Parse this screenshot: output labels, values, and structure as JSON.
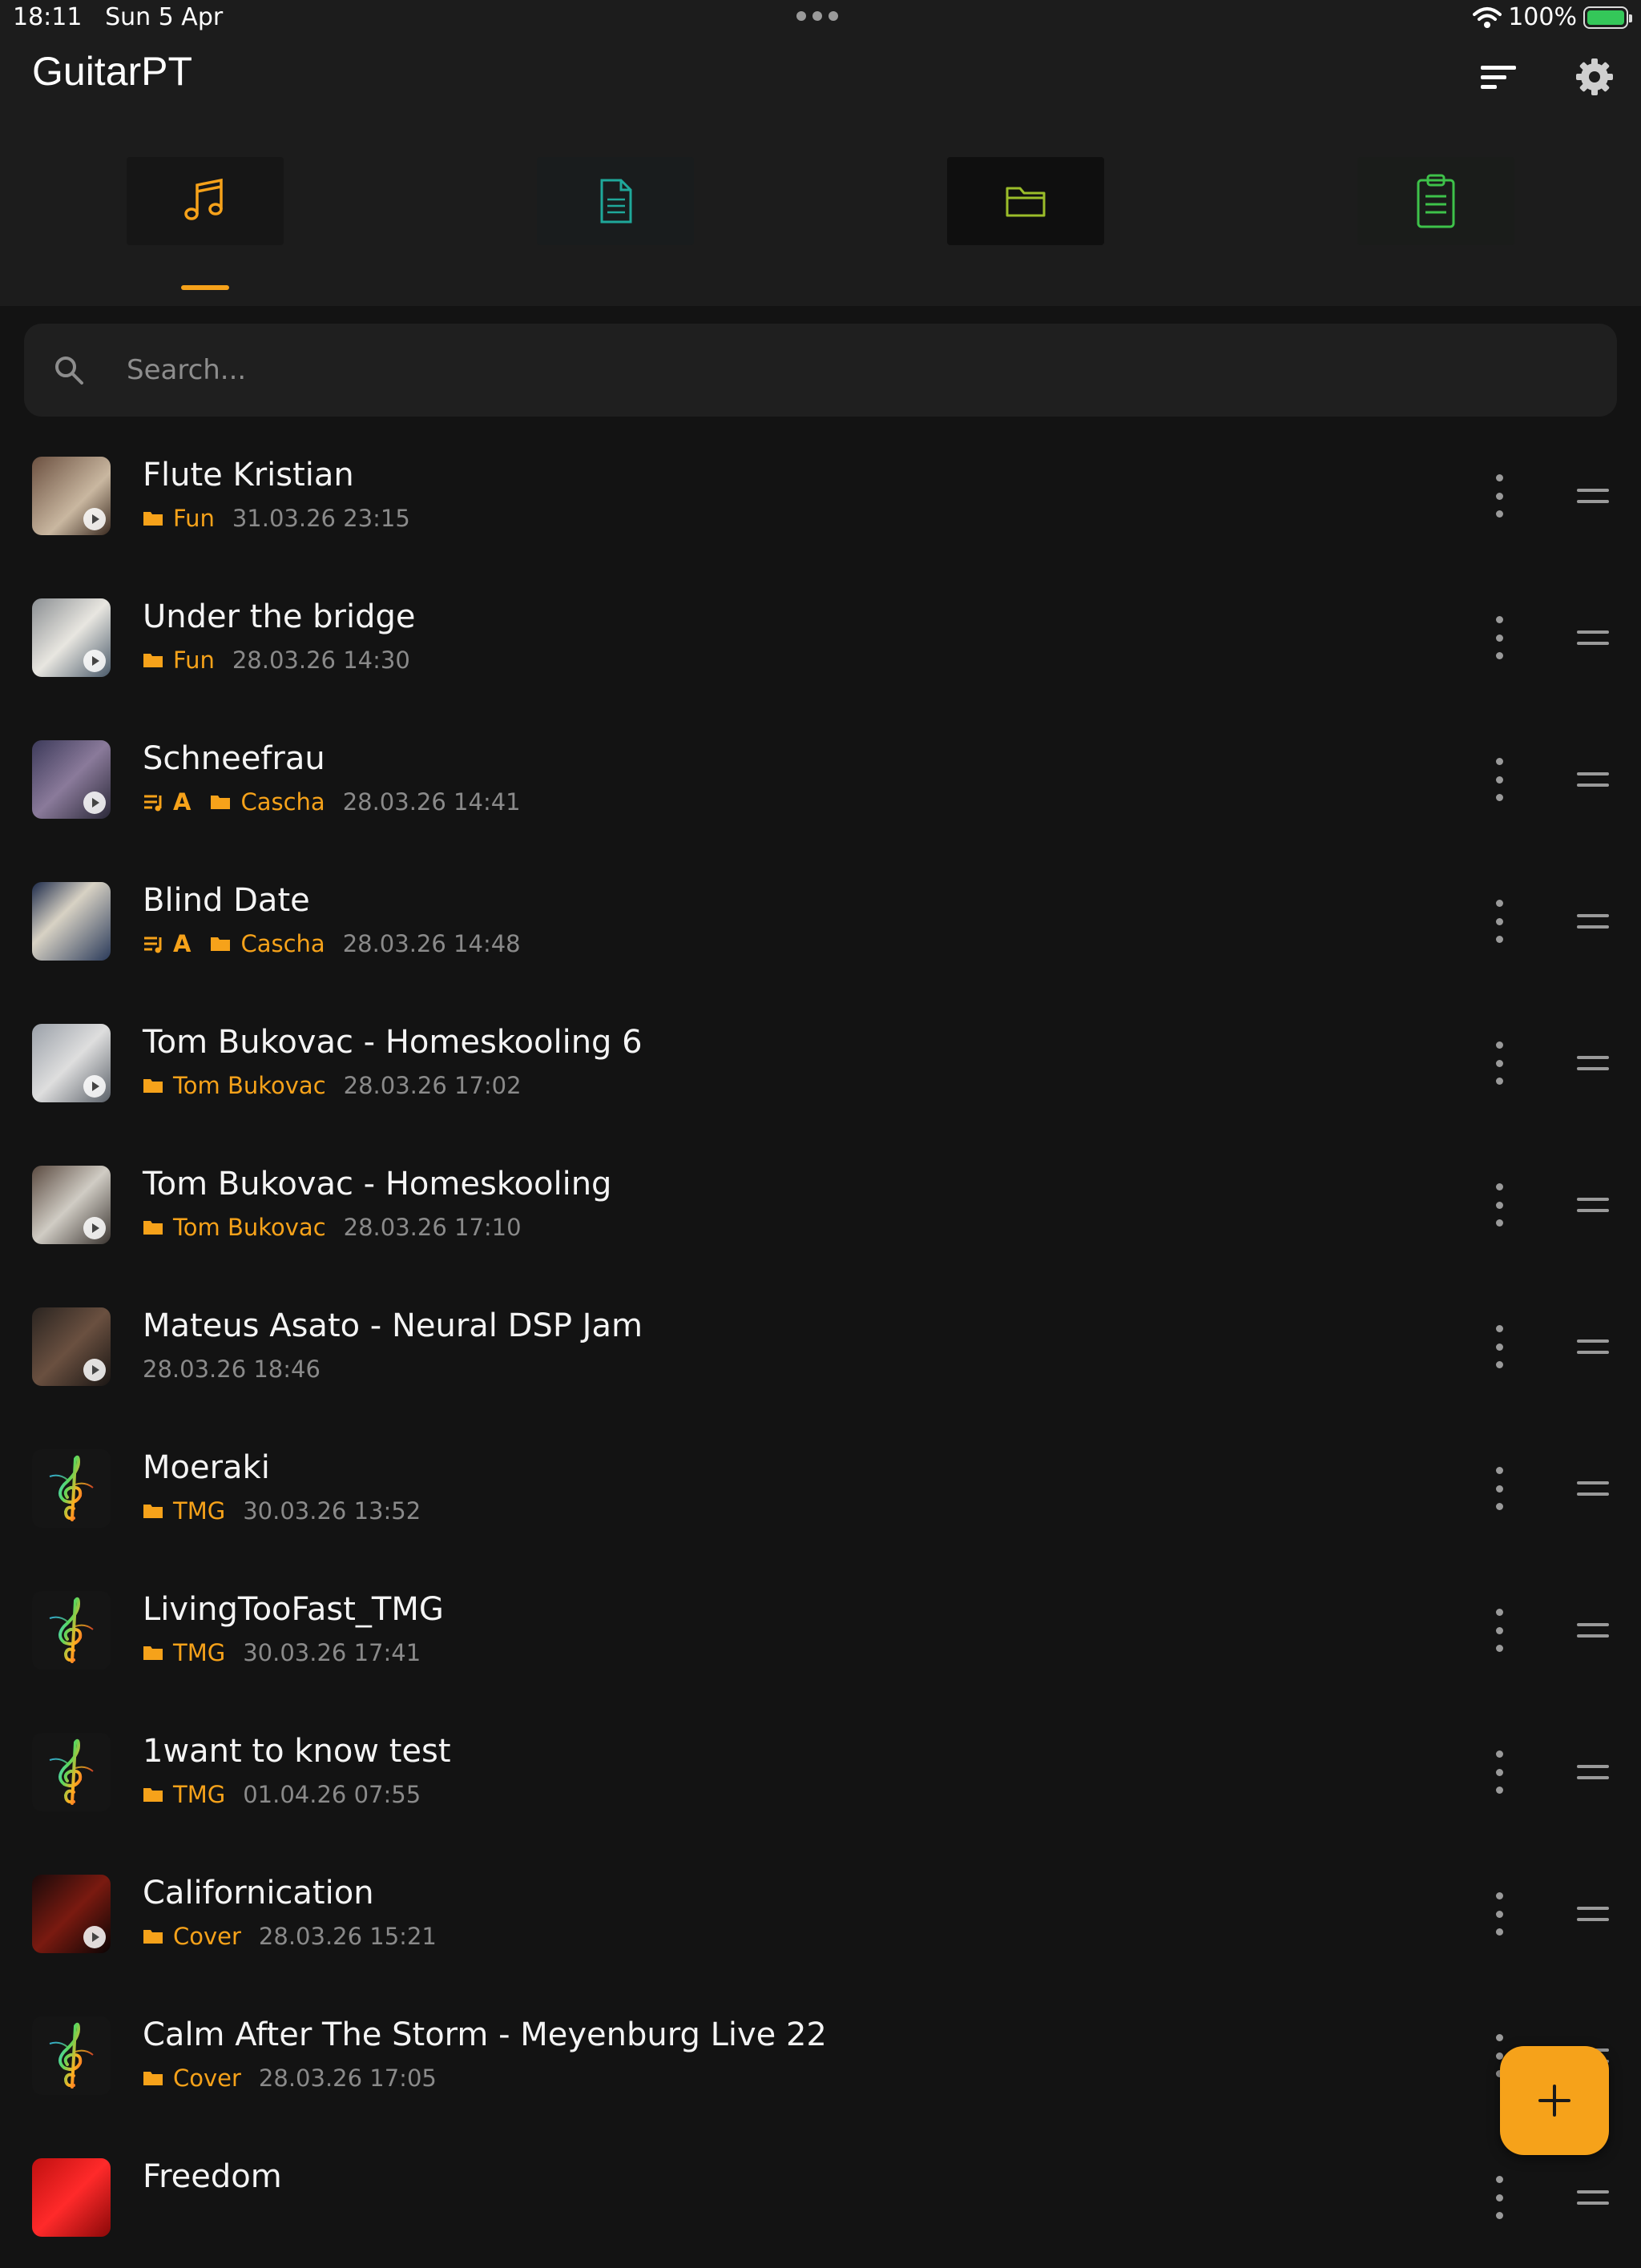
{
  "status_bar": {
    "time": "18:11",
    "date": "Sun 5 Apr",
    "battery": "100%"
  },
  "header": {
    "title": "GuitarPT",
    "sort_icon": "sort-icon",
    "settings_icon": "gear-icon"
  },
  "tabs": [
    {
      "icon": "music-note-icon",
      "color": "#f6a21a",
      "selected": true
    },
    {
      "icon": "document-icon",
      "color": "#1fa89a",
      "selected": false
    },
    {
      "icon": "folder-icon",
      "color": "#9bbd2a",
      "selected": false
    },
    {
      "icon": "clipboard-icon",
      "color": "#3ec24a",
      "selected": false
    }
  ],
  "search": {
    "placeholder": "Search..."
  },
  "accent": "#f6a21a",
  "songs": [
    {
      "title": "Flute Kristian",
      "key": "",
      "folder": "Fun",
      "date": "31.03.26 23:15",
      "thumb": "video"
    },
    {
      "title": "Under the bridge",
      "key": "",
      "folder": "Fun",
      "date": "28.03.26 14:30",
      "thumb": "video"
    },
    {
      "title": "Schneefrau",
      "key": "A",
      "folder": "Cascha",
      "date": "28.03.26 14:41",
      "thumb": "video"
    },
    {
      "title": "Blind Date",
      "key": "A",
      "folder": "Cascha",
      "date": "28.03.26 14:48",
      "thumb": "image"
    },
    {
      "title": "Tom Bukovac - Homeskooling 6",
      "key": "",
      "folder": "Tom Bukovac",
      "date": "28.03.26 17:02",
      "thumb": "video"
    },
    {
      "title": "Tom Bukovac - Homeskooling",
      "key": "",
      "folder": "Tom Bukovac",
      "date": "28.03.26 17:10",
      "thumb": "video"
    },
    {
      "title": "Mateus Asato - Neural DSP Jam",
      "key": "",
      "folder": "",
      "date": "28.03.26 18:46",
      "thumb": "video"
    },
    {
      "title": "Moeraki",
      "key": "",
      "folder": "TMG",
      "date": "30.03.26 13:52",
      "thumb": "clef"
    },
    {
      "title": "LivingTooFast_TMG",
      "key": "",
      "folder": "TMG",
      "date": "30.03.26 17:41",
      "thumb": "clef"
    },
    {
      "title": "1want to know test",
      "key": "",
      "folder": "TMG",
      "date": "01.04.26 07:55",
      "thumb": "clef"
    },
    {
      "title": "Californication",
      "key": "",
      "folder": "Cover",
      "date": "28.03.26 15:21",
      "thumb": "video"
    },
    {
      "title": "Calm After The Storm - Meyenburg Live 22",
      "key": "",
      "folder": "Cover",
      "date": "28.03.26 17:05",
      "thumb": "clef"
    },
    {
      "title": "Freedom",
      "key": "",
      "folder": "",
      "date": "",
      "thumb": "image"
    }
  ],
  "fab": {
    "icon": "plus-icon"
  }
}
